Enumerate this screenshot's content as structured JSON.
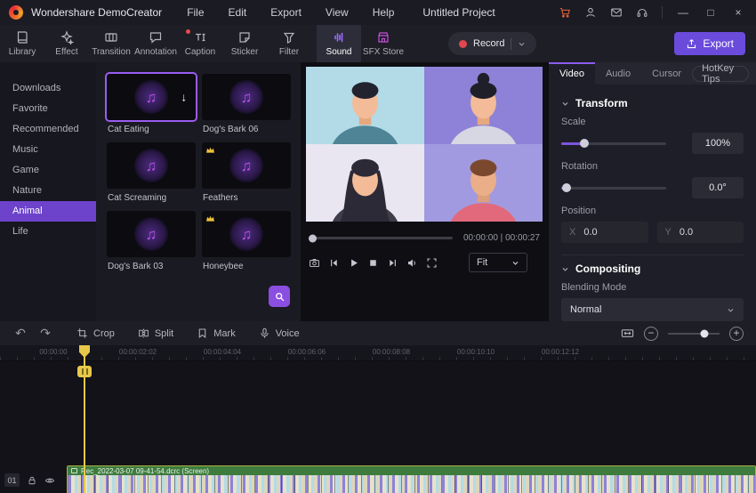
{
  "titlebar": {
    "app_name": "Wondershare DemoCreator",
    "menus": [
      "File",
      "Edit",
      "Export",
      "View",
      "Help"
    ],
    "project_name": "Untitled Project"
  },
  "toolbar": {
    "tools": [
      {
        "label": "Library"
      },
      {
        "label": "Effect"
      },
      {
        "label": "Transition"
      },
      {
        "label": "Annotation"
      },
      {
        "label": "Caption"
      },
      {
        "label": "Sticker"
      },
      {
        "label": "Filter"
      },
      {
        "label": "Sound"
      },
      {
        "label": "SFX Store"
      }
    ],
    "record_label": "Record",
    "export_label": "Export"
  },
  "sidebar": {
    "items": [
      {
        "label": "Downloads"
      },
      {
        "label": "Favorite"
      },
      {
        "label": "Recommended"
      },
      {
        "label": "Music"
      },
      {
        "label": "Game"
      },
      {
        "label": "Nature"
      },
      {
        "label": "Animal"
      },
      {
        "label": "Life"
      }
    ]
  },
  "media": {
    "items": [
      {
        "name": "Cat Eating"
      },
      {
        "name": "Dog's Bark 06"
      },
      {
        "name": "Cat Screaming"
      },
      {
        "name": "Feathers"
      },
      {
        "name": "Dog's Bark 03"
      },
      {
        "name": "Honeybee"
      }
    ]
  },
  "preview": {
    "current_time": "00:00:00",
    "time_separator": "|",
    "duration": "00:00:27",
    "fit_label": "Fit"
  },
  "props": {
    "tabs": [
      "Video",
      "Audio",
      "Cursor",
      "HotKey Tips"
    ],
    "transform": {
      "title": "Transform",
      "scale_label": "Scale",
      "scale_value": "100%",
      "rotation_label": "Rotation",
      "rotation_value": "0.0°",
      "position_label": "Position",
      "x_label": "X",
      "x_value": "0.0",
      "y_label": "Y",
      "y_value": "0.0"
    },
    "compositing": {
      "title": "Compositing",
      "blending_label": "Blending Mode",
      "blending_value": "Normal"
    }
  },
  "tlbar": {
    "buttons": [
      "Crop",
      "Split",
      "Mark",
      "Voice"
    ],
    "zoom_out": "−",
    "zoom_in": "+"
  },
  "timeline": {
    "ruler": [
      "00:00:00",
      "00:00:02:02",
      "00:00:04:04",
      "00:00:06:06",
      "00:00:08:08",
      "00:00:10:10",
      "00:00:12:12"
    ],
    "track_label": "01",
    "clip_name": "Rec_2022-03-07 09-41-54.dcrc (Screen)"
  },
  "icons": {
    "music_note": "♫",
    "download": "↓",
    "undo": "↶",
    "redo": "↷",
    "minimize": "—",
    "maximize": "□",
    "close": "×"
  }
}
